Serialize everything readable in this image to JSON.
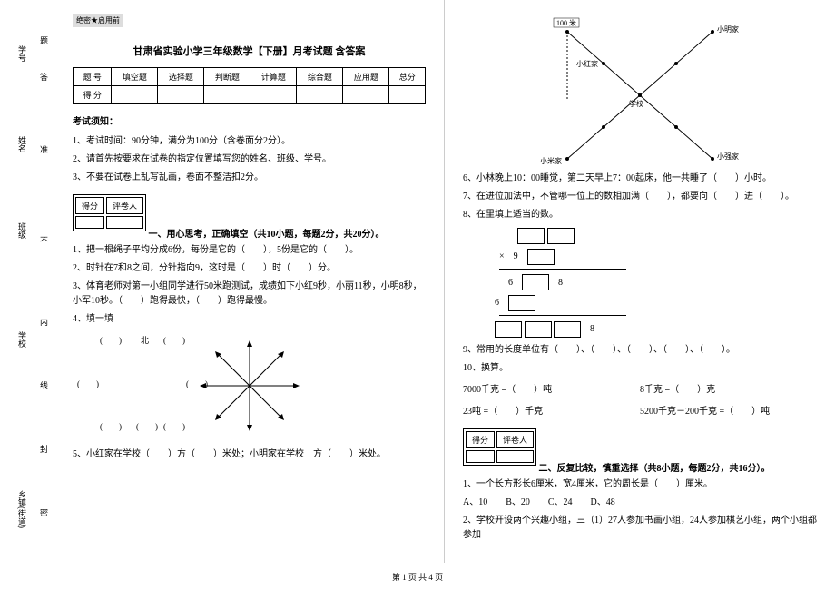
{
  "margin": {
    "labels": [
      "学号",
      "姓名",
      "班级",
      "学校",
      "乡镇(街道)"
    ],
    "seals": [
      "答",
      "题",
      "准",
      "不",
      "内",
      "线",
      "封",
      "密"
    ]
  },
  "header": {
    "secret": "绝密★启用前",
    "title": "甘肃省实验小学三年级数学【下册】月考试题 含答案"
  },
  "scoreTable": {
    "row1": [
      "题 号",
      "填空题",
      "选择题",
      "判断题",
      "计算题",
      "综合题",
      "应用题",
      "总分"
    ],
    "row2": [
      "得 分",
      "",
      "",
      "",
      "",
      "",
      "",
      ""
    ]
  },
  "notice": {
    "title": "考试须知：",
    "items": [
      "1、考试时间：90分钟，满分为100分（含卷面分2分）。",
      "2、请首先按要求在试卷的指定位置填写您的姓名、班级、学号。",
      "3、不要在试卷上乱写乱画，卷面不整洁扣2分。"
    ]
  },
  "scoreBox": {
    "c1": "得分",
    "c2": "评卷人"
  },
  "sec1": {
    "header": "一、用心思考，正确填空（共10小题，每题2分，共20分）。",
    "q1": "1、把一根绳子平均分成6份，每份是它的（　　），5份是它的（　　）。",
    "q2": "2、时针在7和8之间，分针指向9，这时是（　　）时（　　）分。",
    "q3": "3、体育老师对第一小组同学进行50米跑测试，成绩如下小红9秒，小丽11秒，小明8秒，小军10秒。（　　）跑得最快，（　　）跑得最慢。",
    "q4": "4、填一填",
    "compass": {
      "n": "北"
    },
    "q5": "5、小红家在学校（　　）方（　　）米处；小明家在学校　方（　　）米处。",
    "q6": "6、小林晚上10：00睡觉，第二天早上7：00起床，他一共睡了（　　）小时。",
    "q7": "7、在进位加法中，不管哪一位上的数相加满（　　），都要向（　　）进（　　）。",
    "q8": "8、在里填上适当的数。",
    "q9": "9、常用的长度单位有（　　）、（　　）、（　　）、（　　）、（　　）。",
    "q10": "10、换算。",
    "q10a": "7000千克 =（　　）吨",
    "q10b": "8千克 =（　　）克",
    "q10c": "23吨 =（　　）千克",
    "q10d": "5200千克－200千克 =（　　）吨"
  },
  "mult": {
    "r1a": "9",
    "r2a": "6",
    "r2b": "8",
    "r3a": "6",
    "r4a": "8"
  },
  "sec2": {
    "header": "二、反复比较，慎重选择（共8小题，每题2分，共16分）。",
    "q1": "1、一个长方形长6厘米，宽4厘米，它的周长是（　　）厘米。",
    "q1opts": "A、10　　B、20　　C、24　　D、48",
    "q2": "2、学校开设两个兴趣小组，三（1）27人参加书画小组，24人参加棋艺小组，两个小组都参加"
  },
  "map": {
    "topLeft": "100 米",
    "topRight": "小明家",
    "midLeft": "小红家",
    "center": "学校",
    "botLeft": "小米家",
    "botRight": "小强家"
  },
  "footer": "第 1 页 共 4 页"
}
